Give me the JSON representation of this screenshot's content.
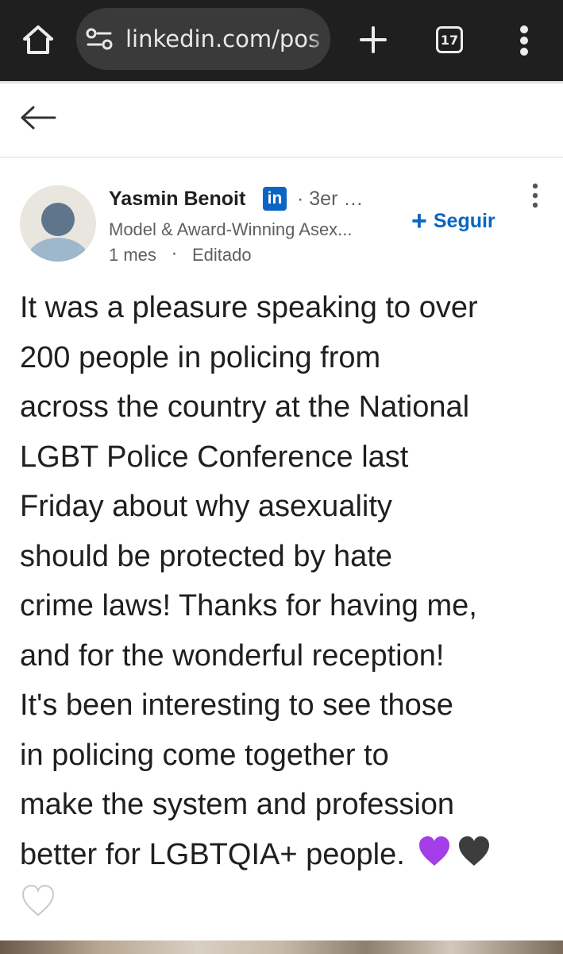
{
  "browser": {
    "url": "linkedin.com/pos",
    "tab_count": "17",
    "icons": {
      "home": "home-icon",
      "site_settings": "tune-icon",
      "new_tab": "plus-icon",
      "menu": "vertical-dots-icon"
    }
  },
  "app_header": {
    "back_icon": "arrow-left-icon"
  },
  "post": {
    "author": {
      "name": "Yasmin Benoit",
      "badge": "in",
      "connection_degree": "· 3er …",
      "headline": "Model & Award-Winning Asex...",
      "time": "1 mes",
      "separator": "·",
      "edited": "Editado"
    },
    "follow_label": "Seguir",
    "follow_icon": "+",
    "menu_icon": "vertical-dots-icon",
    "body_lines": [
      "It was a pleasure speaking to over",
      "200 people in policing from",
      "across the country at the National",
      "LGBT Police Conference last",
      "Friday about why asexuality",
      "should be protected by hate",
      "crime laws! Thanks for having me,",
      "and for the wonderful reception!",
      "It's been interesting to see those",
      "in policing come together to",
      "make the system and profession",
      "better for LGBTQIA+ people."
    ],
    "emoji_hearts": [
      "purple-heart",
      "black-heart",
      "white-heart"
    ]
  },
  "colors": {
    "linkedin_blue": "#0a66c2",
    "browser_bar": "#1f1f1f",
    "url_pill": "#3a3a3a",
    "purple_heart": "#a33ee8",
    "black_heart": "#3d3d3d",
    "white_heart": "#ffffff"
  }
}
